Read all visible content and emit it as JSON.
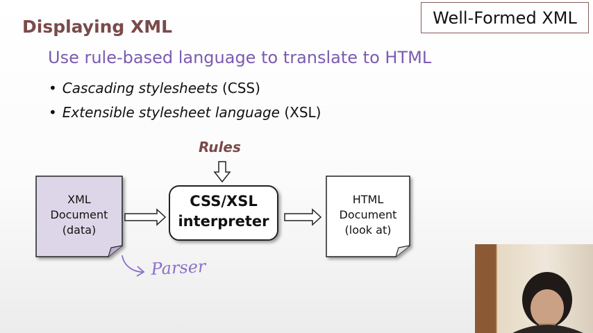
{
  "slide": {
    "badge": "Well-Formed XML",
    "title": "Displaying XML",
    "subtitle": "Use rule-based language to translate to HTML",
    "bullets": [
      {
        "dot": "•",
        "italic": "Cascading stylesheets",
        "rest": " (CSS)"
      },
      {
        "dot": "•",
        "italic": "Extensible stylesheet language",
        "rest": " (XSL)"
      }
    ]
  },
  "diagram": {
    "rules": "Rules",
    "xml_doc": [
      "XML",
      "Document",
      "(data)"
    ],
    "interpreter": [
      "CSS/XSL",
      "interpreter"
    ],
    "html_doc": [
      "HTML",
      "Document",
      "(look at)"
    ],
    "annotation": "Parser"
  },
  "colors": {
    "title": "#7a4a4a",
    "subtitle": "#7b5bb0",
    "xml_doc_fill": "#ddd6e8",
    "annotation": "#8a70c8"
  }
}
